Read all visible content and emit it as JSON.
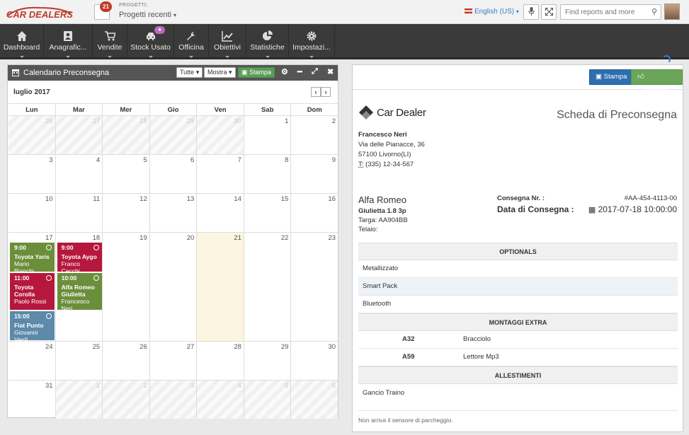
{
  "topbar": {
    "logo_text": "CAR DEALERS",
    "projects_badge": "21",
    "projects_label": "PROGETTI:",
    "projects_value": "Progetti recenti",
    "language": "English (US)",
    "search_placeholder": "Find reports and more"
  },
  "nav": {
    "items": [
      {
        "label": "Dashboard",
        "icon": "home-icon"
      },
      {
        "label": "Anagrafic...",
        "icon": "contacts-icon"
      },
      {
        "label": "Vendite",
        "icon": "cart-icon"
      },
      {
        "label": "Stock Usato",
        "icon": "car-icon"
      },
      {
        "label": "Officina",
        "icon": "wrench-icon"
      },
      {
        "label": "Obiettivi",
        "icon": "chart-icon"
      },
      {
        "label": "Statistiche",
        "icon": "pie-icon"
      },
      {
        "label": "Impostazi...",
        "icon": "gear-icon"
      }
    ]
  },
  "calendar": {
    "title": "Calendario Preconsegna",
    "filter_all": "Tutte",
    "filter_show": "Mostra",
    "print": "Stampa",
    "month": "luglio 2017",
    "days": [
      "Lun",
      "Mar",
      "Mer",
      "Gio",
      "Ven",
      "Sab",
      "Dom"
    ],
    "weeks": [
      [
        "26",
        "27",
        "28",
        "29",
        "30",
        "1",
        "2"
      ],
      [
        "3",
        "4",
        "5",
        "6",
        "7",
        "8",
        "9"
      ],
      [
        "10",
        "11",
        "12",
        "13",
        "14",
        "15",
        "16"
      ],
      [
        "17",
        "18",
        "19",
        "20",
        "21",
        "22",
        "23"
      ],
      [
        "24",
        "25",
        "26",
        "27",
        "28",
        "29",
        "30"
      ],
      [
        "31",
        "1",
        "2",
        "3",
        "4",
        "5",
        "6"
      ]
    ],
    "events": [
      {
        "time": "9:00",
        "model": "Toyota Yaris",
        "client": "Mario Bianchi",
        "color": "#6b8e3b"
      },
      {
        "time": "11:00",
        "model": "Toyota Corolla",
        "client": "Paolo Rossi",
        "color": "#b5183c"
      },
      {
        "time": "15:00",
        "model": "Fiat Punto",
        "client": "Giovanni Verdi",
        "color": "#5c8aa8"
      },
      {
        "time": "9:00",
        "model": "Toyota Aygo",
        "client": "Franco Cecchi",
        "color": "#b5183c"
      },
      {
        "time": "10:00",
        "model": "Alfa Romeo Giulietta",
        "client": "Francesco Neri",
        "color": "#6b8e3b"
      }
    ]
  },
  "doc": {
    "print_btn": "Stampa",
    "deliver_btn": "Consegna",
    "brand": "Car Dealer",
    "title": "Scheda di Preconsegna",
    "customer": {
      "name": "Francesco Neri",
      "street": "Via delle Pianacce, 36",
      "city": "57100 Livorno(LI)",
      "phone_label": "T:",
      "phone": "(335) 12-34-567"
    },
    "car": {
      "make": "Alfa Romeo",
      "model": "Giulietta 1.8 3p",
      "plate": "Targa: AA904BB",
      "chassis": "Telaio:"
    },
    "delivery_no_label": "Consegna Nr. :",
    "delivery_no": "#AA-454-4113-00",
    "delivery_date_label": "Data di Consegna :",
    "delivery_date": "2017-07-18 10:00:00",
    "optionals_title": "OPTIONALS",
    "optionals": [
      "Metallizzato",
      "Smart Pack",
      "Bluetooth"
    ],
    "extra_title": "MONTAGGI EXTRA",
    "extras": [
      {
        "code": "A32",
        "name": "Bracciolo"
      },
      {
        "code": "A59",
        "name": "Lettore Mp3"
      }
    ],
    "fittings_title": "ALLESTIMENTI",
    "fittings": [
      "Gancio Traino"
    ],
    "note": "Non arriva il sensore di parcheggio."
  }
}
